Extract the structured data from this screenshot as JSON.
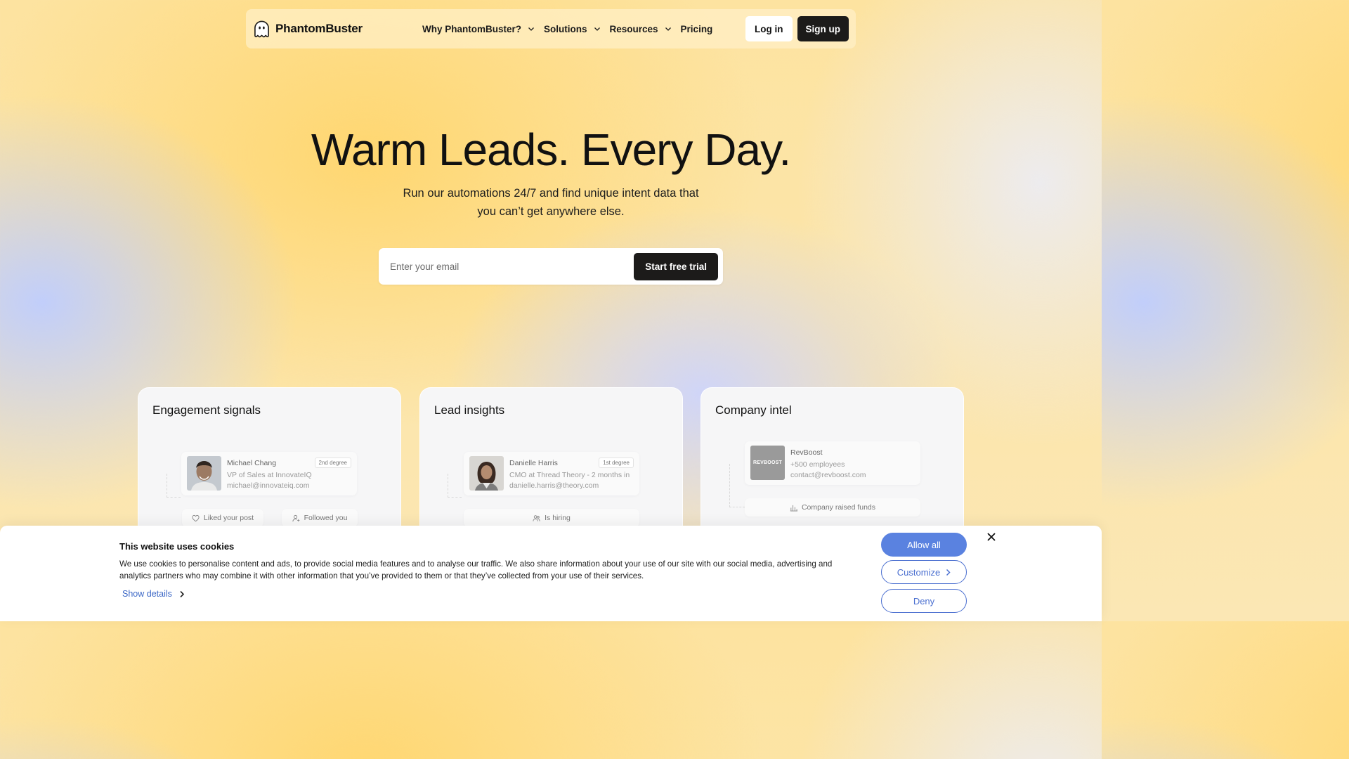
{
  "nav": {
    "brand": "PhantomBuster",
    "items": [
      {
        "label": "Why PhantomBuster?",
        "has_dropdown": true
      },
      {
        "label": "Solutions",
        "has_dropdown": true
      },
      {
        "label": "Resources",
        "has_dropdown": true
      },
      {
        "label": "Pricing",
        "has_dropdown": false
      }
    ],
    "login_label": "Log in",
    "signup_label": "Sign up"
  },
  "hero": {
    "title": "Warm Leads. Every Day.",
    "subtitle_line1": "Run our automations 24/7 and find unique intent data that",
    "subtitle_line2": "you can’t get anywhere else.",
    "email_placeholder": "Enter your email",
    "cta_label": "Start free trial"
  },
  "cards": [
    {
      "title": "Engagement signals",
      "profile": {
        "name": "Michael Chang",
        "role": "VP of Sales at InnovateIQ",
        "email": "michael@innovateiq.com",
        "degree": "2nd degree"
      },
      "signals": [
        "Liked your post",
        "Followed you"
      ]
    },
    {
      "title": "Lead insights",
      "profile": {
        "name": "Danielle Harris",
        "role": "CMO at Thread Theory - 2 months in",
        "email": "danielle.harris@theory.com",
        "degree": "1st degree"
      },
      "signals": [
        "Is hiring"
      ]
    },
    {
      "title": "Company intel",
      "company": {
        "logo_text": "REVBOOST",
        "name": "RevBoost",
        "size": "+500 employees",
        "email": "contact@revboost.com"
      },
      "signals": [
        "Company raised funds"
      ]
    }
  ],
  "cookie_banner": {
    "title": "This website uses cookies",
    "text": "We use cookies to personalise content and ads, to provide social media features and to analyse our traffic. We also share information about your use of our site with our social media, advertising and analytics partners who may combine it with other information that you’ve provided to them or that they’ve collected from your use of their services.",
    "show_details_label": "Show details",
    "allow_label": "Allow all",
    "customize_label": "Customize",
    "deny_label": "Deny"
  },
  "colors": {
    "dark_button": "#1c1b1a",
    "cookie_accent": "#5a82e0",
    "link_blue": "#3b67c6"
  }
}
